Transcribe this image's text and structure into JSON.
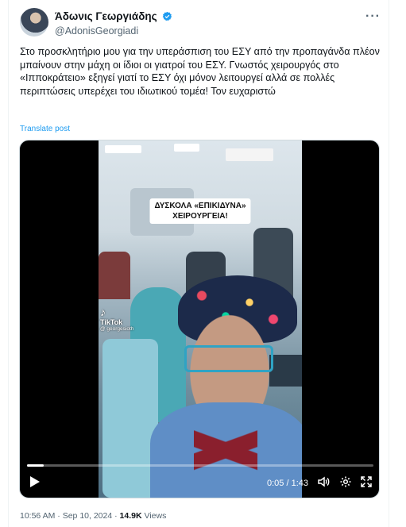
{
  "author": {
    "display_name": "Άδωνις Γεωργιάδης",
    "handle": "@AdonisGeorgiadi",
    "verified": true
  },
  "tweet": {
    "text": "Στο προσκλητήριο μου για την υπεράσπιση του ΕΣΥ από την προπαγάνδα πλέον μπαίνουν στην μάχη οι ίδιοι οι γιατροί του ΕΣΥ. Γνωστός χειρουργός στο «Ιπποκράτειο» εξηγεί γιατί το ΕΣΥ όχι μόνον λειτουργεί αλλά σε πολλές περιπτώσεις υπερέχει του ιδιωτικού τομέα! Τον ευχαριστώ",
    "translate_label": "Translate post"
  },
  "video": {
    "caption_line1": "ΔΥΣΚΟΛΑ «ΕΠΙΚΙΔΥΝΑ»",
    "caption_line2": "ΧΕΙΡΟΥΡΓΕΙΑ!",
    "watermark_brand": "TikTok",
    "watermark_user": "@ georgesioth",
    "time": "0:05 / 1:43",
    "progress": 0.049
  },
  "meta": {
    "time": "10:56 AM",
    "separator": "·",
    "date": "Sep 10, 2024",
    "views_count": "14.9K",
    "views_label": "Views"
  },
  "colors": {
    "verified": "#1d9bf0",
    "link": "#1d9bf0",
    "secondary_text": "#536471"
  },
  "icons": [
    "more-icon",
    "verified-badge-icon",
    "play-icon",
    "volume-icon",
    "settings-icon",
    "fullscreen-icon",
    "tiktok-logo-icon"
  ]
}
